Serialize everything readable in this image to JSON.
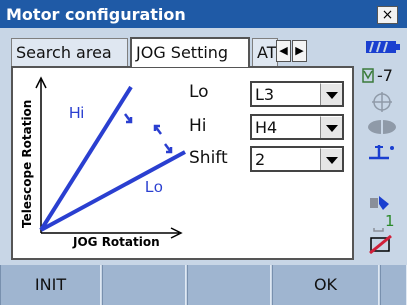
{
  "window": {
    "title": "Motor configuration",
    "close_label": "×"
  },
  "tabs": [
    {
      "label": "Search area",
      "active": false
    },
    {
      "label": "JOG Setting",
      "active": true
    },
    {
      "label": "AT S",
      "active": false
    }
  ],
  "graph": {
    "y_axis_label": "Telescope Rotation",
    "x_axis_label": "JOG Rotation",
    "hi_label": "Hi",
    "lo_label": "Lo"
  },
  "fields": {
    "lo": {
      "label": "Lo",
      "value": "L3"
    },
    "hi": {
      "label": "Hi",
      "value": "H4"
    },
    "shift": {
      "label": "Shift",
      "value": "2"
    }
  },
  "status": {
    "compensation_text": "-7",
    "prism_constant": "1"
  },
  "softkeys": [
    "INIT",
    "",
    "",
    "",
    "OK",
    ""
  ],
  "colors": {
    "titlebar": "#1f5aa6",
    "accent_blue": "#2a3fd0",
    "background": "#c8d6e6",
    "softkey": "#9fb5d0"
  }
}
